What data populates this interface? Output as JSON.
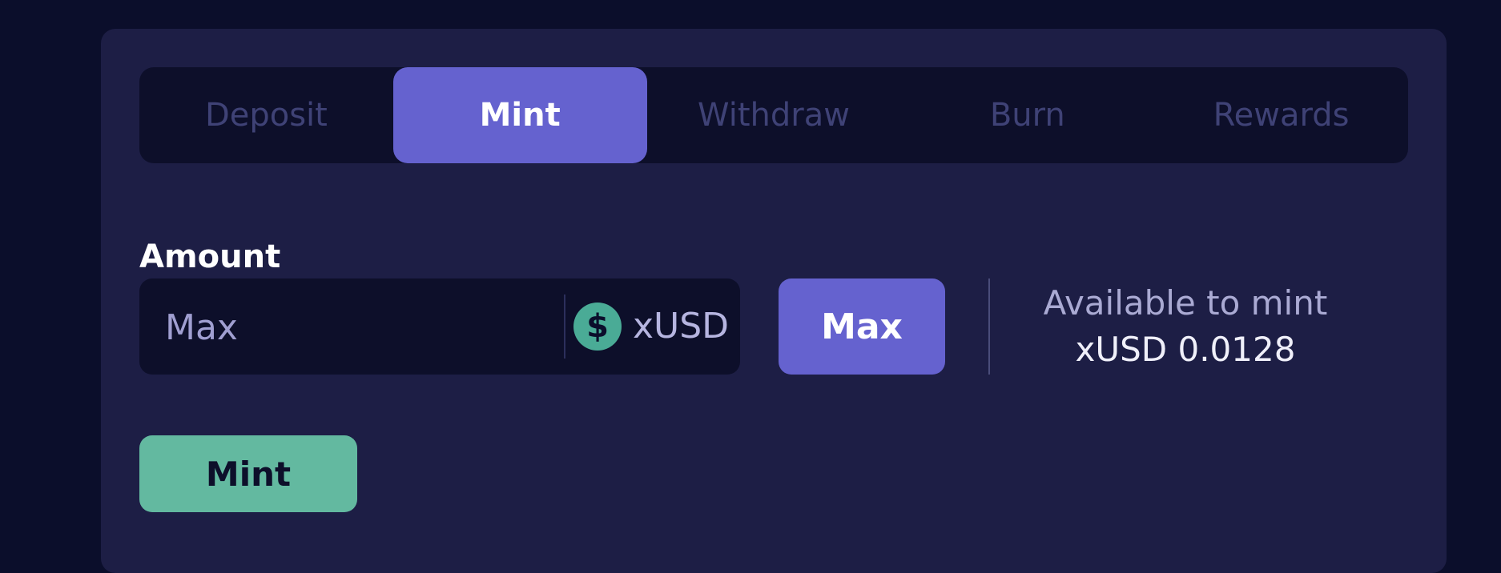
{
  "tabs": [
    {
      "label": "Deposit",
      "active": false
    },
    {
      "label": "Mint",
      "active": true
    },
    {
      "label": "Withdraw",
      "active": false
    },
    {
      "label": "Burn",
      "active": false
    },
    {
      "label": "Rewards",
      "active": false
    }
  ],
  "amount": {
    "label": "Amount",
    "placeholder": "Max",
    "value": "",
    "token": "xUSD",
    "token_icon": "dollar-coin-icon"
  },
  "max_button": {
    "label": "Max"
  },
  "available": {
    "label": "Available to mint",
    "value": "xUSD 0.0128"
  },
  "action_button": {
    "label": "Mint"
  },
  "colors": {
    "background": "#0b0e2b",
    "panel": "#1d1e45",
    "accent": "#6562cf",
    "success": "#63b9a0",
    "tab_inactive_text": "#3f4276"
  }
}
